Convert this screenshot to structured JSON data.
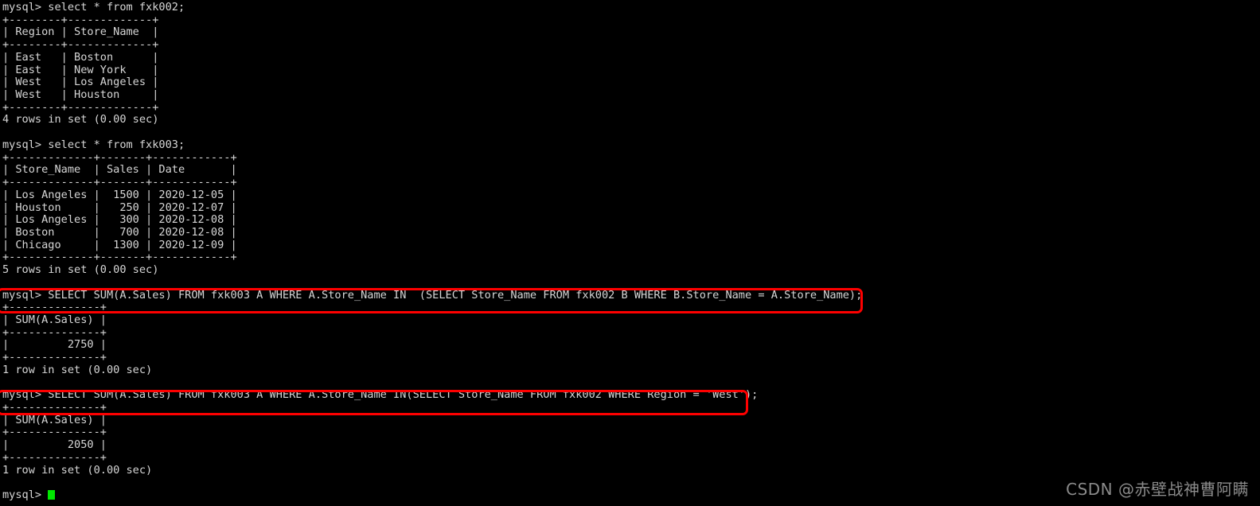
{
  "terminal": {
    "prompt": "mysql> ",
    "background_color": "#000000",
    "text_color": "#d6d6d6",
    "cursor_color": "#00e800",
    "highlight_color": "#fe0000",
    "lines": [
      "mysql> select * from fxk002;",
      "+--------+-------------+",
      "| Region | Store_Name  |",
      "+--------+-------------+",
      "| East   | Boston      |",
      "| East   | New York    |",
      "| West   | Los Angeles |",
      "| West   | Houston     |",
      "+--------+-------------+",
      "4 rows in set (0.00 sec)",
      "",
      "mysql> select * from fxk003;",
      "+-------------+-------+------------+",
      "| Store_Name  | Sales | Date       |",
      "+-------------+-------+------------+",
      "| Los Angeles |  1500 | 2020-12-05 |",
      "| Houston     |   250 | 2020-12-07 |",
      "| Los Angeles |   300 | 2020-12-08 |",
      "| Boston      |   700 | 2020-12-08 |",
      "| Chicago     |  1300 | 2020-12-09 |",
      "+-------------+-------+------------+",
      "5 rows in set (0.00 sec)",
      "",
      "mysql> SELECT SUM(A.Sales) FROM fxk003 A WHERE A.Store_Name IN  (SELECT Store_Name FROM fxk002 B WHERE B.Store_Name = A.Store_Name);",
      "+--------------+",
      "| SUM(A.Sales) |",
      "+--------------+",
      "|         2750 |",
      "+--------------+",
      "1 row in set (0.00 sec)",
      "",
      "mysql> SELECT SUM(A.Sales) FROM fxk003 A WHERE A.Store_Name IN(SELECT Store_Name FROM fxk002 WHERE Region = 'West');",
      "+--------------+",
      "| SUM(A.Sales) |",
      "+--------------+",
      "|         2050 |",
      "+--------------+",
      "1 row in set (0.00 sec)",
      ""
    ],
    "final_prompt": "mysql> "
  },
  "highlights": [
    {
      "label": "correlated-subquery-statement",
      "statement": "mysql> SELECT SUM(A.Sales) FROM fxk003 A WHERE A.Store_Name IN  (SELECT Store_Name FROM fxk002 B WHERE B.Store_Name = A.Store_Name);"
    },
    {
      "label": "region-west-subquery-statement",
      "statement": "mysql> SELECT SUM(A.Sales) FROM fxk003 A WHERE A.Store_Name IN(SELECT Store_Name FROM fxk002 WHERE Region = 'West');"
    }
  ],
  "watermark": {
    "text": "CSDN @赤壁战神曹阿瞒"
  }
}
